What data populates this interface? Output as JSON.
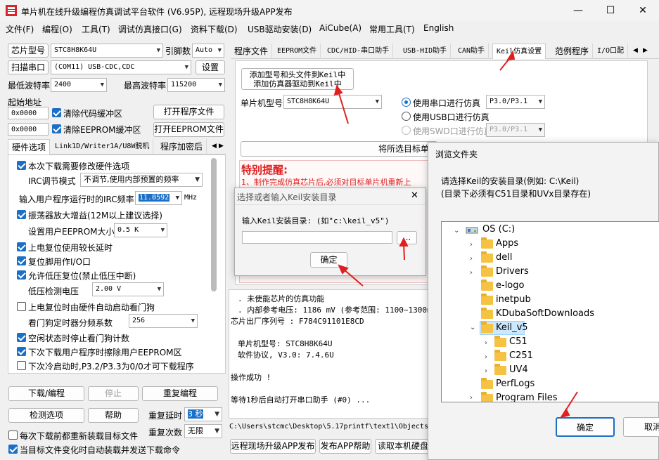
{
  "window": {
    "title": "单片机在线升级编程仿真调试平台软件 (V6.95P), 远程现场升级APP发布",
    "minimize": "—",
    "maximize": "☐",
    "close": "✕"
  },
  "menu": [
    "文件(F)",
    "编程(O)",
    "工具(T)",
    "调试仿真接口(G)",
    "资料下载(D)",
    "USB驱动安装(D)",
    "AiCube(A)",
    "常用工具(T)",
    "English"
  ],
  "left": {
    "chip_model_btn": "芯片型号",
    "chip_model_value": "STC8H8K64U",
    "pin_count_label": "引脚数",
    "pin_count_value": "Auto",
    "scan_port_btn": "扫描串口",
    "port_value": "(COM11) USB-CDC,CDC",
    "settings_btn": "设置",
    "min_baud_label": "最低波特率",
    "min_baud_value": "2400",
    "max_baud_label": "最高波特率",
    "max_baud_value": "115200",
    "start_addr_label": "起始地址",
    "code_addr": "0x0000",
    "clear_code_label": "清除代码缓冲区",
    "open_program_btn": "打开程序文件",
    "eeprom_addr": "0x0000",
    "clear_eeprom_label": "清除EEPROM缓冲区",
    "open_eeprom_btn": "打开EEPROM文件",
    "tabs": [
      "硬件选项",
      "Link1D/Writer1A/U8W脱机",
      "程序加密后"
    ],
    "options": {
      "modify_hw": "本次下载需要修改硬件选项",
      "irc_mode_label": "IRC调节模式",
      "irc_mode_value": "不调节,使用内部预置的频率",
      "irc_freq_label": "输入用户程序运行时的IRC频率",
      "irc_freq_value": "11.0592",
      "irc_unit": "MHz",
      "osc_gain": "振荡器放大增益(12M以上建议选择)",
      "eeprom_size_label": "设置用户EEPROM大小",
      "eeprom_size_value": "0.5 K",
      "long_delay": "上电复位使用较长延时",
      "reset_pin_io": "复位脚用作I/O口",
      "low_volt_reset": "允许低压复位(禁止低压中断)",
      "low_volt_label": "低压检测电压",
      "low_volt_value": "2.00 V",
      "hw_watchdog": "上电复位时由硬件自动启动看门狗",
      "wdt_prescale_label": "看门狗定时器分频系数",
      "wdt_prescale_value": "256",
      "idle_stop_wdt": "空闲状态时停止看门狗计数",
      "erase_eeprom": "下次下载用户程序时擦除用户EEPROM区",
      "cold_boot": "下次冷启动时,P3.2/P3.3为0/0才可下载程序"
    },
    "download_btn": "下载/编程",
    "stop_btn": "停止",
    "reprogram_btn": "重复编程",
    "detect_btn": "检测选项",
    "help_btn": "帮助",
    "repeat_delay_label": "重复延时",
    "repeat_delay_value": "3 秒",
    "repeat_count_label": "重复次数",
    "repeat_count_value": "无限",
    "reload_each": "每次下载前都重新装载目标文件",
    "auto_reload": "当目标文件变化时自动装载并发送下载命令"
  },
  "right": {
    "tabs": [
      "程序文件",
      "EEPROM文件",
      "CDC/HID-串口助手",
      "USB-HID助手",
      "CAN助手",
      "Keil仿真设置",
      "范例程序",
      "I/O口配"
    ],
    "add_keil_btn_line1": "添加型号和头文件到Keil中",
    "add_keil_btn_line2": "添加仿真器驱动到Keil中",
    "mcu_model_label": "单片机型号",
    "mcu_model_value": "STC8H8K64U",
    "use_serial": "使用串口进行仿真",
    "serial_port_value": "P3.0/P3.1",
    "use_usb": "使用USB口进行仿真",
    "use_swd": "使用SWD口进行仿真",
    "swd_value": "P3.0/P3.1",
    "set_target_btn": "将所选目标单",
    "notice_title": "特别提醒:",
    "notice_text": "1、制作完成仿真芯片后,必须对目标单片机重新上",
    "console": [
      ". 未使能芯片的仿真功能",
      ". 内部参考电压: 1186 mV (参考范围: 1100~1300m",
      "芯片出厂序列号 : F784C91101E8CD",
      "",
      "单片机型号: STC8H8K64U",
      "软件协议, V3.0: 7.4.6U",
      "",
      "操作成功 !",
      "",
      "等待1秒后自动打开串口助手 (#0) ..."
    ],
    "path": "C:\\Users\\stcmc\\Desktop\\5.17printf\\text1\\Objects",
    "bottom_btns": [
      "远程现场升级APP发布",
      "发布APP帮助",
      "读取本机硬盘"
    ],
    "bottom_partial": "F"
  },
  "keil_dialog": {
    "title": "选择或者输入Keil安装目录",
    "close": "✕",
    "prompt": "输入Keil安装目录: (如\"c:\\keil_v5\")",
    "input_value": "",
    "browse_btn": "...",
    "ok_btn": "确定"
  },
  "browse_dialog": {
    "title": "浏览文件夹",
    "desc_line1": "请选择Keil的安装目录(例如: C:\\Keil)",
    "desc_line2": "(目录下必须有C51目录和UVx目录存在)",
    "tree": {
      "drive": "OS (C:)",
      "folders": [
        "Apps",
        "dell",
        "Drivers",
        "e-logo",
        "inetpub",
        "KDubaSoftDownloads",
        "Keil_v5",
        "PerfLogs",
        "Program Files"
      ],
      "keil_children": [
        "C51",
        "C251",
        "UV4"
      ]
    },
    "ok_btn": "确定",
    "cancel_btn": "取消"
  },
  "colors": {
    "accent": "#1a6fc7",
    "warning": "#e02020",
    "selection": "#cce8ff"
  }
}
